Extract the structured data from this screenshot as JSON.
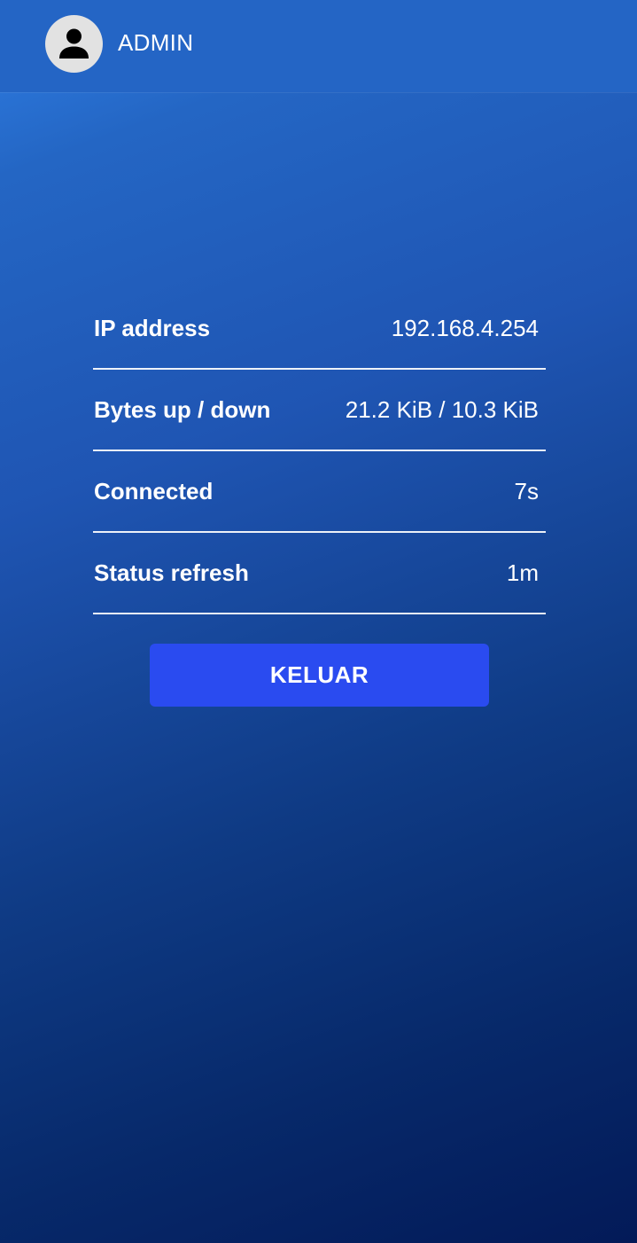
{
  "header": {
    "avatar_icon": "user-icon",
    "username": "ADMIN"
  },
  "status": {
    "rows": [
      {
        "label": "IP address",
        "value": "192.168.4.254"
      },
      {
        "label": "Bytes up / down",
        "value": "21.2 KiB / 10.3 KiB"
      },
      {
        "label": "Connected",
        "value": "7s"
      },
      {
        "label": "Status refresh",
        "value": "1m"
      }
    ]
  },
  "actions": {
    "logout_label": "KELUAR"
  },
  "colors": {
    "header_bg": "#2465c5",
    "button_bg": "#2a4bf0",
    "background_top": "#2f7fe6",
    "background_bottom": "#031a58"
  }
}
